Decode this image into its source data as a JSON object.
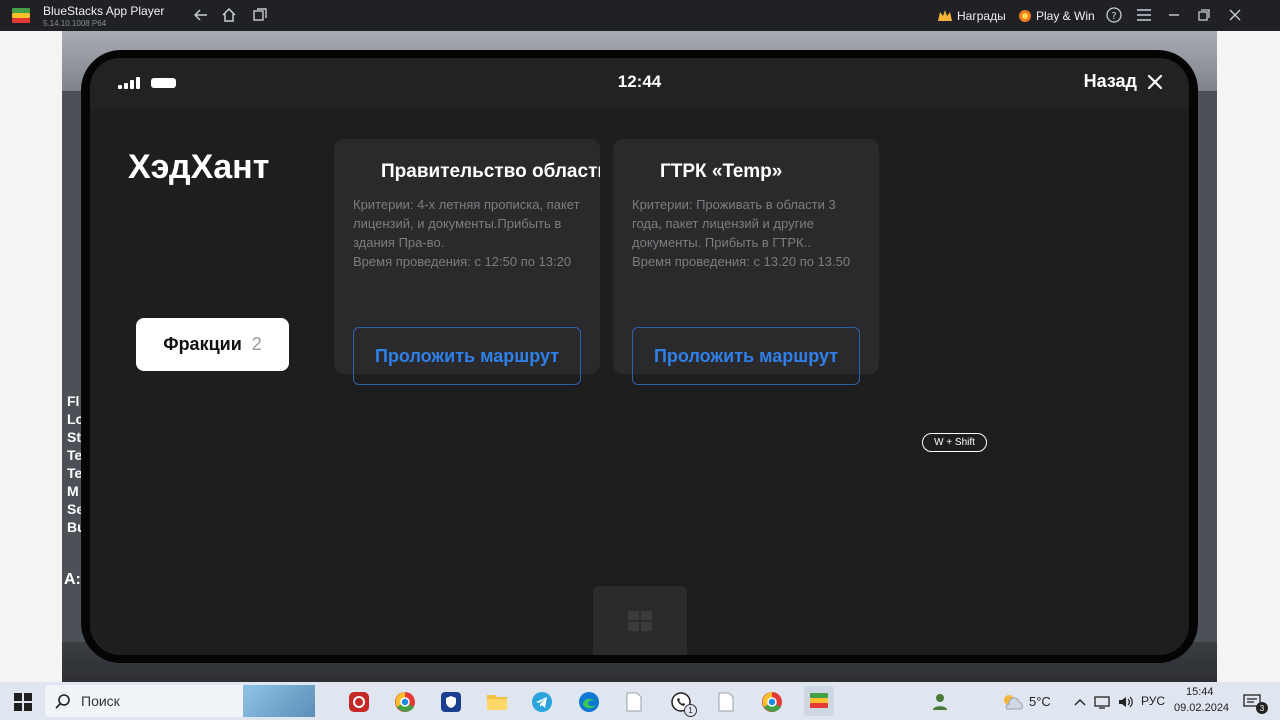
{
  "window": {
    "app_name": "BlueStacks App Player",
    "version": "5.14.10.1008  P64",
    "rewards_label": "Награды",
    "play_win_label": "Play & Win"
  },
  "scene": {
    "left_letters": [
      "Fl",
      "Lo",
      "St",
      "Te",
      "Te",
      "M",
      "Se",
      "Bu"
    ],
    "bottom_letter": "A:"
  },
  "phone": {
    "time": "12:44",
    "back_label": "Назад",
    "org_title": "ХэдХант",
    "factions_label": "Фракции",
    "factions_count": "2",
    "hint_badge": "W + Shift",
    "cards": [
      {
        "title": "Правительство области",
        "description": "Критерии: 4-х летняя прописка, пакет лицензий, и документы.Прибыть в здания Пра-во.\nВремя проведения: с 12:50 по 13:20",
        "button_label": "Проложить маршрут"
      },
      {
        "title": "ГТРК «Temp»",
        "description": "Критерии: Проживать в области 3 года, пакет лицензий и другие документы. Прибыть в ГТРК..\nВремя проведения: с 13.20 по 13.50",
        "button_label": "Проложить маршрут"
      }
    ]
  },
  "taskbar": {
    "search_placeholder": "Поиск",
    "weather": "5°C",
    "language": "РУС",
    "time": "15:44",
    "date": "09.02.2024",
    "notification_count": "3",
    "whatsapp_badge": "1"
  },
  "colors": {
    "accent_blue": "#2f80ea",
    "card_bg": "#2a2a2c",
    "screen_bg": "#1e1e1f"
  }
}
